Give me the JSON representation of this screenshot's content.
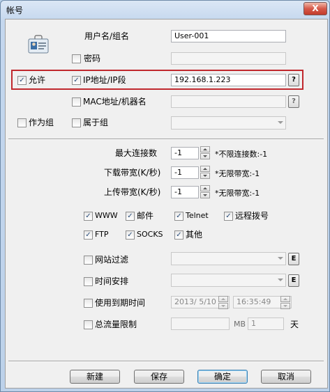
{
  "window": {
    "title": "帐号",
    "close_glyph": "X"
  },
  "account": {
    "username_label": "用户名/组名",
    "username_value": "User-001",
    "password_label": "密码",
    "password_checked": false,
    "allow_label": "允许",
    "allow_checked": true,
    "ip_label": "IP地址/IP段",
    "ip_checked": true,
    "ip_value": "192.168.1.223",
    "help_glyph": "?",
    "mac_label": "MAC地址/机器名",
    "mac_checked": false,
    "as_group_label": "作为组",
    "as_group_checked": false,
    "belongs_group_label": "属于组",
    "belongs_group_checked": false
  },
  "limits": {
    "max_conn_label": "最大连接数",
    "max_conn_value": "-1",
    "max_conn_hint": "*不限连接数:-1",
    "download_label": "下载带宽(K/秒)",
    "download_value": "-1",
    "download_hint": "*无限带宽:-1",
    "upload_label": "上传带宽(K/秒)",
    "upload_value": "-1",
    "upload_hint": "*无限带宽:-1"
  },
  "services": [
    {
      "label": "WWW",
      "checked": true
    },
    {
      "label": "邮件",
      "checked": true
    },
    {
      "label": "Telnet",
      "checked": true
    },
    {
      "label": "远程拨号",
      "checked": true
    },
    {
      "label": "FTP",
      "checked": true
    },
    {
      "label": "SOCKS",
      "checked": true
    },
    {
      "label": "其他",
      "checked": true
    }
  ],
  "filters": {
    "web_filter_label": "网站过滤",
    "web_filter_checked": false,
    "schedule_label": "时间安排",
    "schedule_checked": false,
    "edit_glyph": "E",
    "expiry_label": "使用到期时间",
    "expiry_checked": false,
    "expiry_date": "2013/ 5/10",
    "expiry_time": "16:35:49",
    "traffic_label": "总流量限制",
    "traffic_checked": false,
    "traffic_value": "",
    "traffic_unit": "MB",
    "traffic_days": "1",
    "traffic_day_unit": "天"
  },
  "buttons": {
    "new": "新建",
    "save": "保存",
    "ok": "确定",
    "cancel": "取消"
  },
  "colors": {
    "highlight": "#c0282d",
    "title_bg": "#c4d7ee",
    "close_bg": "#d6594a"
  },
  "check_glyph": "✓"
}
